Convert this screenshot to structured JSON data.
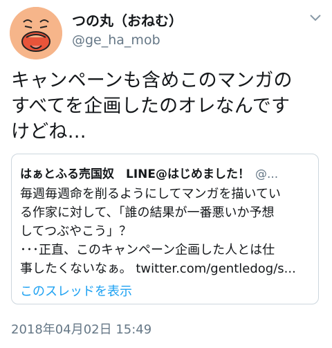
{
  "author": {
    "display_name": "つの丸（おねむ）",
    "handle": "@ge_ha_mob"
  },
  "tweet": {
    "lines": [
      "キャンペーンも含めこのマンガの",
      "すべてを企画したのオレなんです",
      "けどね…"
    ]
  },
  "quoted": {
    "display_name": "はぁとふる売国奴　LINE@はじめました！",
    "handle": "@...",
    "lines": [
      "毎週毎週命を削るようにしてマンガを描いてい",
      "る作家に対して、「誰の結果が一番悪いか予想",
      "してつぶやこう」？",
      "･･･正直、このキャンペーン企画した人とは仕",
      "事したくないなぁ。 twitter.com/gentledog/s..."
    ],
    "thread_link": "このスレッドを表示"
  },
  "timestamp": "2018年04月02日 15:49",
  "icons": {
    "menu": "chevron-down-icon",
    "avatar": "avatar"
  }
}
